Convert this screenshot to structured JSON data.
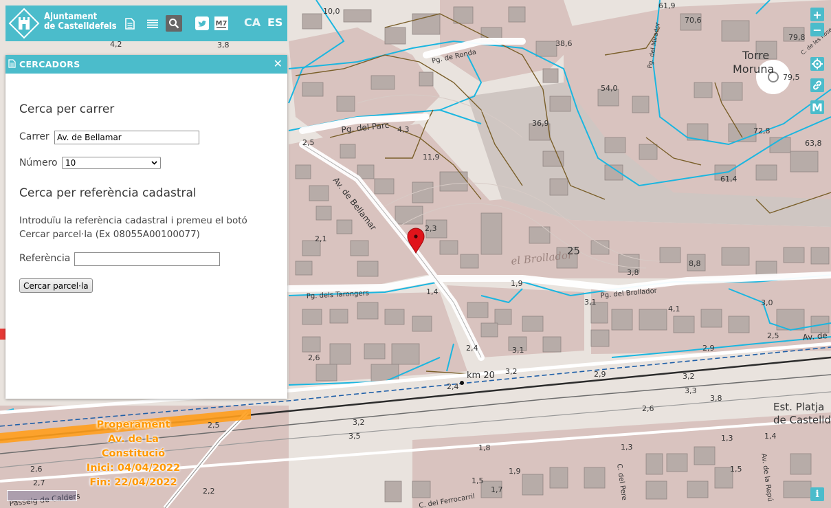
{
  "header": {
    "brand_line1": "Ajuntament",
    "brand_line2": "de Castelldefels",
    "icons": [
      "document-icon",
      "layers-list-icon",
      "search-icon",
      "twitter-icon",
      "m7-icon"
    ],
    "m7_label": "M7",
    "languages": [
      {
        "code": "CA",
        "active": true
      },
      {
        "code": "ES",
        "active": false
      }
    ]
  },
  "panel": {
    "title": "CERCADORS",
    "street_search": {
      "heading": "Cerca per carrer",
      "street_label": "Carrer",
      "street_value": "Av. de Bellamar",
      "number_label": "Número",
      "number_value": "10"
    },
    "cadastral_search": {
      "heading": "Cerca per referència cadastral",
      "description_line1": "Introduïu la referència cadastral i premeu el botó",
      "description_line2": "Cercar parcel·la (Ex 08055A00100077)",
      "reference_label": "Referència",
      "reference_value": "",
      "button_label": "Cercar parcel·la"
    }
  },
  "map_controls": {
    "zoom_in": "+",
    "zoom_out": "−",
    "locate_icon": "crosshair-icon",
    "link_icon": "link-icon",
    "m_button": "M",
    "info": "i"
  },
  "notice": {
    "line1": "Properament",
    "line2": "Av. de La Constitució",
    "line3": "Inici: 04/04/2022",
    "line4": "Fin: 22/04/2022"
  },
  "map_labels": {
    "streets": [
      "Pg. de Ronda",
      "Pg. del Parc",
      "Av. de Bellamar",
      "Pg. dels Tarongers",
      "Pg. del Brollador",
      "Pg. del Mirador",
      "C. de les Roses",
      "Av. de",
      "C. del Ferrocarril",
      "C. del Pere",
      "Av. de la Repú",
      "Passeig de Calders"
    ],
    "places": [
      "Torre Moruna",
      "el Brollador",
      "Est. Platja de Castelldefels",
      "km 20"
    ],
    "elevations": [
      "10,0",
      "61,9",
      "70,6",
      "79,8",
      "4,2",
      "3,8",
      "38,6",
      "54,0",
      "79,5",
      "36,9",
      "72,8",
      "4,3",
      "11,9",
      "63,8",
      "2,5",
      "61,4",
      "2,1",
      "2,3",
      "25",
      "3,8",
      "8,8",
      "1,9",
      "1,4",
      "3,1",
      "4,1",
      "3,0",
      "2,5",
      "2,6",
      "2,4",
      "3,1",
      "3,2",
      "2,9",
      "2,9",
      "3,2",
      "3,3",
      "2,4",
      "3,8",
      "2,5",
      "3,2",
      "3,5",
      "2,6",
      "1,8",
      "1,3",
      "1,4",
      "2,6",
      "2,7",
      "1,5",
      "1,9",
      "1,7",
      "2,2",
      "1,5"
    ]
  },
  "colors": {
    "accent": "#4bbccb",
    "notice": "#ff9800",
    "marker": "#e0141b",
    "urban_fill": "#dcc7c3",
    "building_fill": "#b4a9a5",
    "water_line": "#1ab6e0",
    "contour_line": "#7a5f2a",
    "road_outline": "#ffffff",
    "rail_line": "#222222",
    "dashed_boundary": "#1f5fa8"
  }
}
